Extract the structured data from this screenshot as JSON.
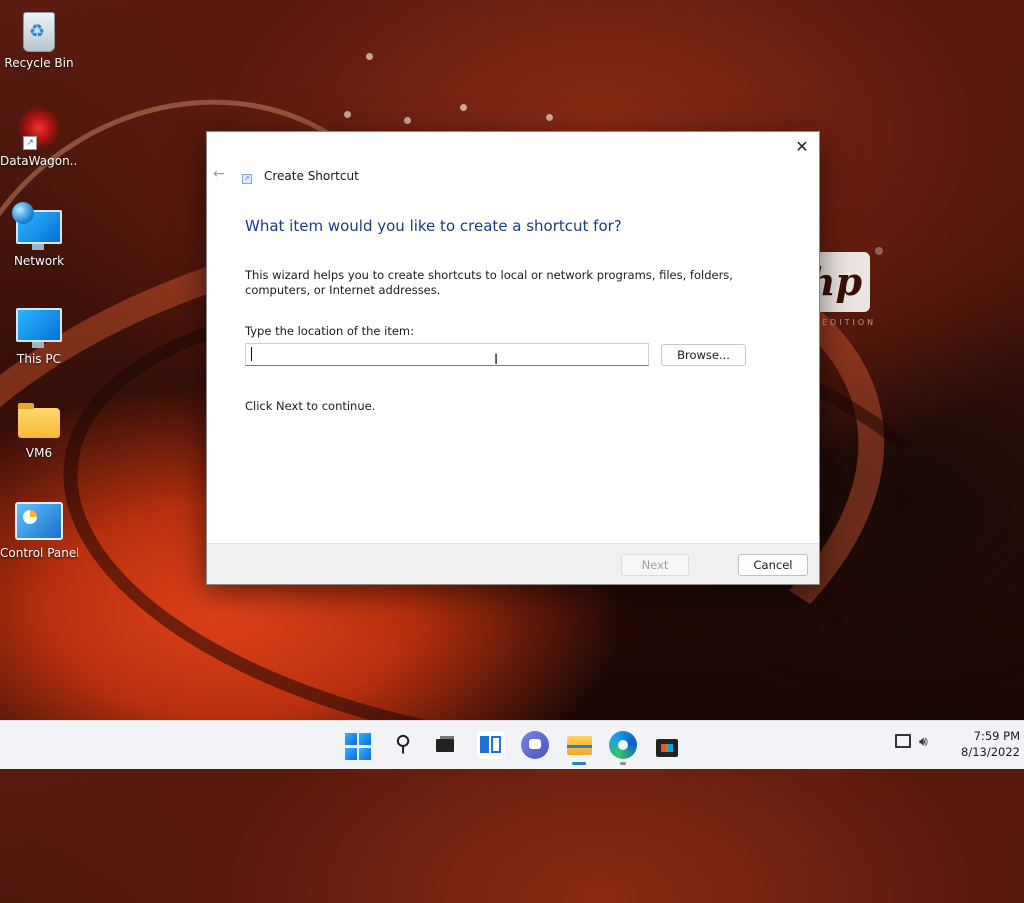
{
  "desktop": {
    "icons": [
      {
        "label": "Recycle Bin",
        "icon": "recycle-bin-icon"
      },
      {
        "label": "DataWagon...",
        "icon": "datawagon-shortcut-icon"
      },
      {
        "label": "Network",
        "icon": "network-icon"
      },
      {
        "label": "This PC",
        "icon": "this-pc-icon"
      },
      {
        "label": "VM6",
        "icon": "folder-icon"
      },
      {
        "label": "Control Panel",
        "icon": "control-panel-icon"
      }
    ],
    "wallpaper_logo": {
      "text": "hp",
      "subtext": "EDITION"
    }
  },
  "dialog": {
    "title": "Create Shortcut",
    "heading": "What item would you like to create a shortcut for?",
    "description": "This wizard helps you to create shortcuts to local or network programs, files, folders, computers, or Internet addresses.",
    "location_label": "Type the location of the item:",
    "location_value": "",
    "browse_label": "Browse...",
    "continue_text": "Click Next to continue.",
    "next_label": "Next",
    "cancel_label": "Cancel",
    "close_symbol": "✕",
    "back_symbol": "←"
  },
  "taskbar": {
    "items": [
      "start-icon",
      "search-icon",
      "task-view-icon",
      "widgets-icon",
      "chat-icon",
      "file-explorer-icon",
      "edge-icon",
      "store-icon"
    ],
    "clock": {
      "time": "7:59 PM",
      "date": "8/13/2022"
    }
  },
  "colors": {
    "heading": "#1a3c8c",
    "accent": "#2a7fd4"
  }
}
